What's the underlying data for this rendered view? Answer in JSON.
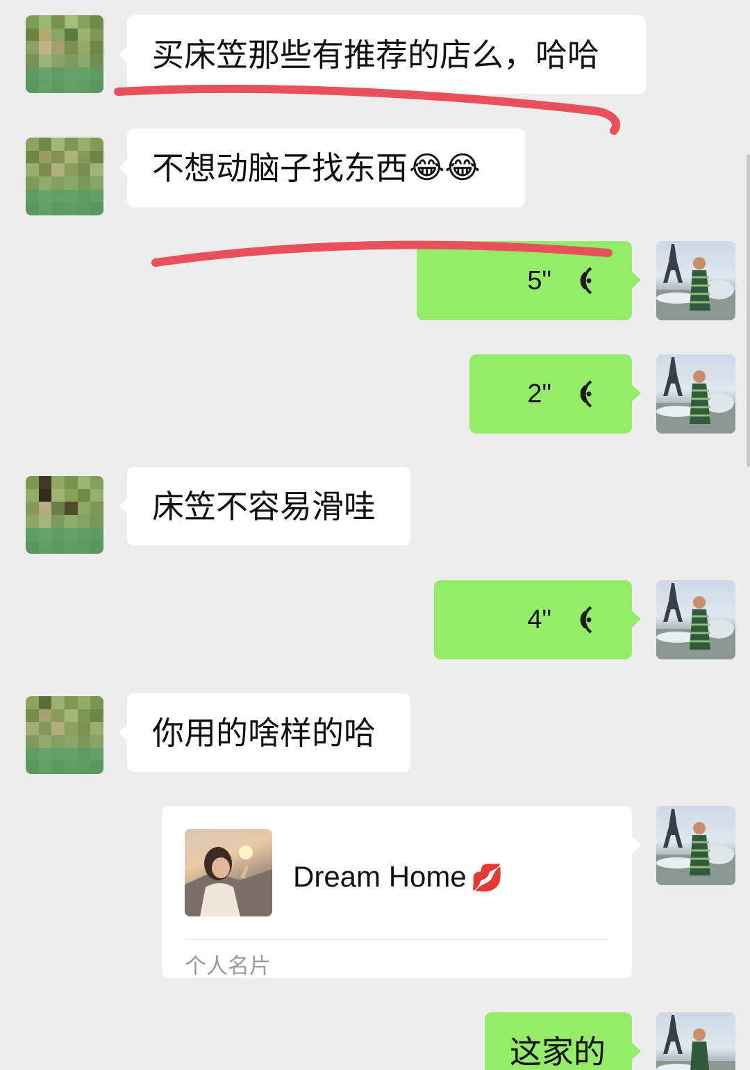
{
  "messages": [
    {
      "side": "left",
      "type": "text",
      "text": "买床笠那些有推荐的店么，哈哈"
    },
    {
      "side": "left",
      "type": "text",
      "text": "不想动脑子找东西",
      "emoji": "😂😂"
    },
    {
      "side": "right",
      "type": "voice",
      "duration": "5\""
    },
    {
      "side": "right",
      "type": "voice",
      "duration": "2\""
    },
    {
      "side": "left",
      "type": "text",
      "text": "床笠不容易滑哇"
    },
    {
      "side": "right",
      "type": "voice",
      "duration": "4\""
    },
    {
      "side": "left",
      "type": "text",
      "text": "你用的啥样的哈"
    },
    {
      "side": "right",
      "type": "contact_card",
      "name": "Dream Home",
      "name_suffix": "💋",
      "label": "个人名片"
    },
    {
      "side": "right",
      "type": "text",
      "text": "这家的"
    }
  ],
  "colors": {
    "background": "#ededed",
    "incoming_bubble": "#ffffff",
    "outgoing_bubble": "#95ec69",
    "annotation": "#e8505b"
  },
  "icons": {
    "voice": "voice-wave-icon",
    "contact_photo": "contact-avatar"
  }
}
